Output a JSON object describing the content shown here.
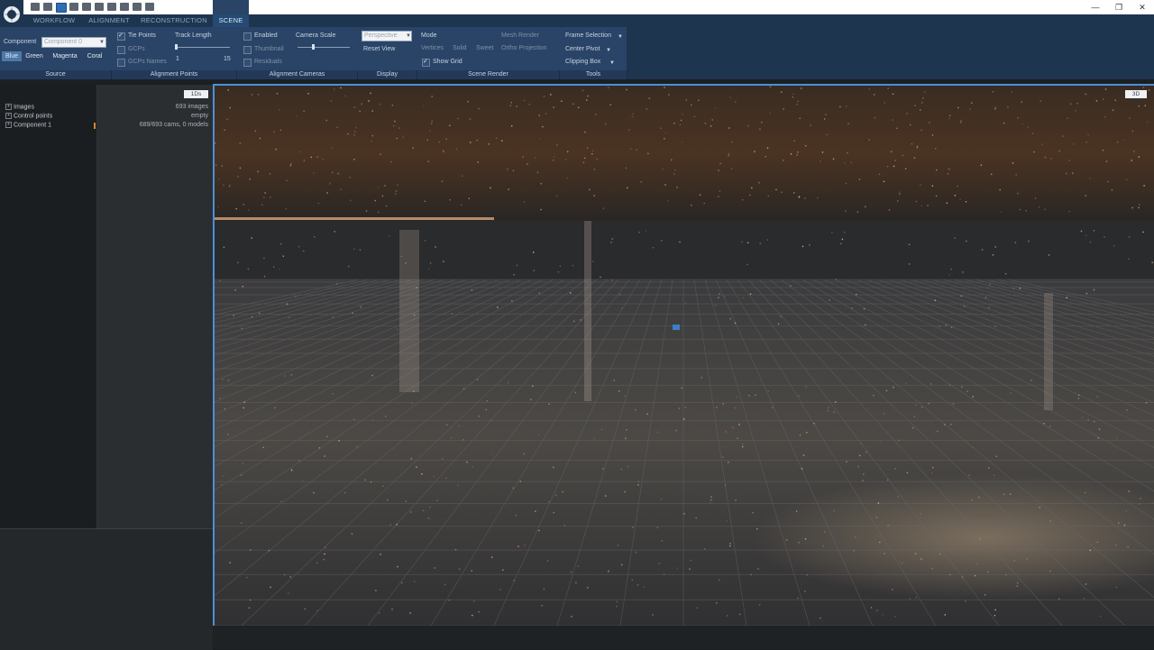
{
  "app": {
    "menu_tabs": [
      "WORKFLOW",
      "ALIGNMENT",
      "RECONSTRUCTION",
      "SCENE"
    ],
    "active_tab": "SCENE",
    "accent": "#4b90d6",
    "ribbon_bg": "#2a4467"
  },
  "source": {
    "component_label": "Component",
    "component_value": "Component 0",
    "colors": [
      "Blue",
      "Green",
      "Magenta",
      "Coral"
    ],
    "active_color": "Blue",
    "footer": "Source"
  },
  "alignment_points": {
    "tie_points": "Tie Points",
    "gcps": "GCPs",
    "gcps_names": "GCPs Names",
    "track_length": "Track Length",
    "track_min": "1",
    "track_max": "15",
    "footer": "Alignment Points"
  },
  "alignment_cameras": {
    "enabled": "Enabled",
    "thumbnail": "Thumbnail",
    "residuals": "Residuals",
    "camera_scale": "Camera Scale",
    "footer": "Alignment Cameras"
  },
  "display": {
    "projection_value": "Perspective",
    "reset_view": "Reset View",
    "footer": "Display"
  },
  "scene_render": {
    "mode": "Mode",
    "vertices": "Vertices",
    "solid": "Solid",
    "sweet": "Sweet",
    "mesh_render": "Mesh Render",
    "ortho_projection": "Ortho Projection",
    "show_grid": "Show Grid",
    "footer": "Scene Render"
  },
  "tools": {
    "frame_selection": "Frame Selection",
    "center_pivot": "Center Pivot",
    "clipping_box": "Clipping Box",
    "footer": "Tools"
  },
  "project_tree": {
    "view_tag": "1Ds",
    "items": [
      {
        "label": "Images",
        "value": "693 images"
      },
      {
        "label": "Control points",
        "value": "empty"
      },
      {
        "label": "Component 1",
        "value": "689/693 cams, 0 models"
      }
    ]
  },
  "viewport": {
    "view_tag": "3D"
  }
}
